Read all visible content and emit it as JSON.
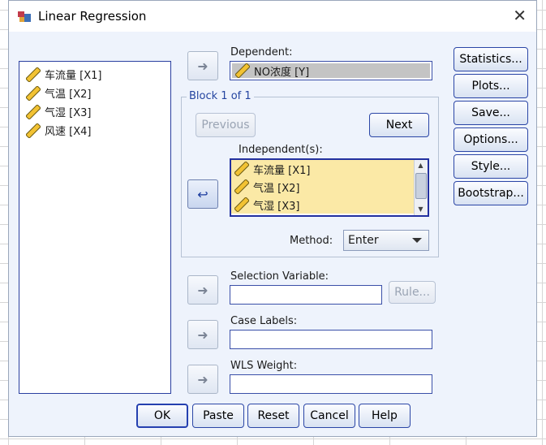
{
  "window": {
    "title": "Linear Regression"
  },
  "variables": [
    {
      "label": "车流量 [X1]"
    },
    {
      "label": "气温 [X2]"
    },
    {
      "label": "气湿 [X3]"
    },
    {
      "label": "风速 [X4]"
    }
  ],
  "dependent": {
    "label": "Dependent:",
    "value": "NO浓度 [Y]"
  },
  "block": {
    "title": "Block 1 of 1",
    "previous": "Previous",
    "next": "Next"
  },
  "independent": {
    "label": "Independent(s):",
    "items": [
      "车流量 [X1]",
      "气温 [X2]",
      "气湿 [X3]"
    ]
  },
  "method": {
    "label": "Method:",
    "value": "Enter"
  },
  "selection": {
    "label": "Selection Variable:",
    "rule": "Rule..."
  },
  "case_labels": {
    "label": "Case Labels:"
  },
  "wls": {
    "label": "WLS Weight:"
  },
  "side_buttons": {
    "statistics": "Statistics...",
    "plots": "Plots...",
    "save": "Save...",
    "options": "Options...",
    "style": "Style...",
    "bootstrap": "Bootstrap..."
  },
  "bottom_buttons": {
    "ok": "OK",
    "paste": "Paste",
    "reset": "Reset",
    "cancel": "Cancel",
    "help": "Help"
  },
  "colors": {
    "accent": "#2540b0",
    "selection": "#fbe9a6",
    "dialog_bg": "#eef3fc"
  }
}
